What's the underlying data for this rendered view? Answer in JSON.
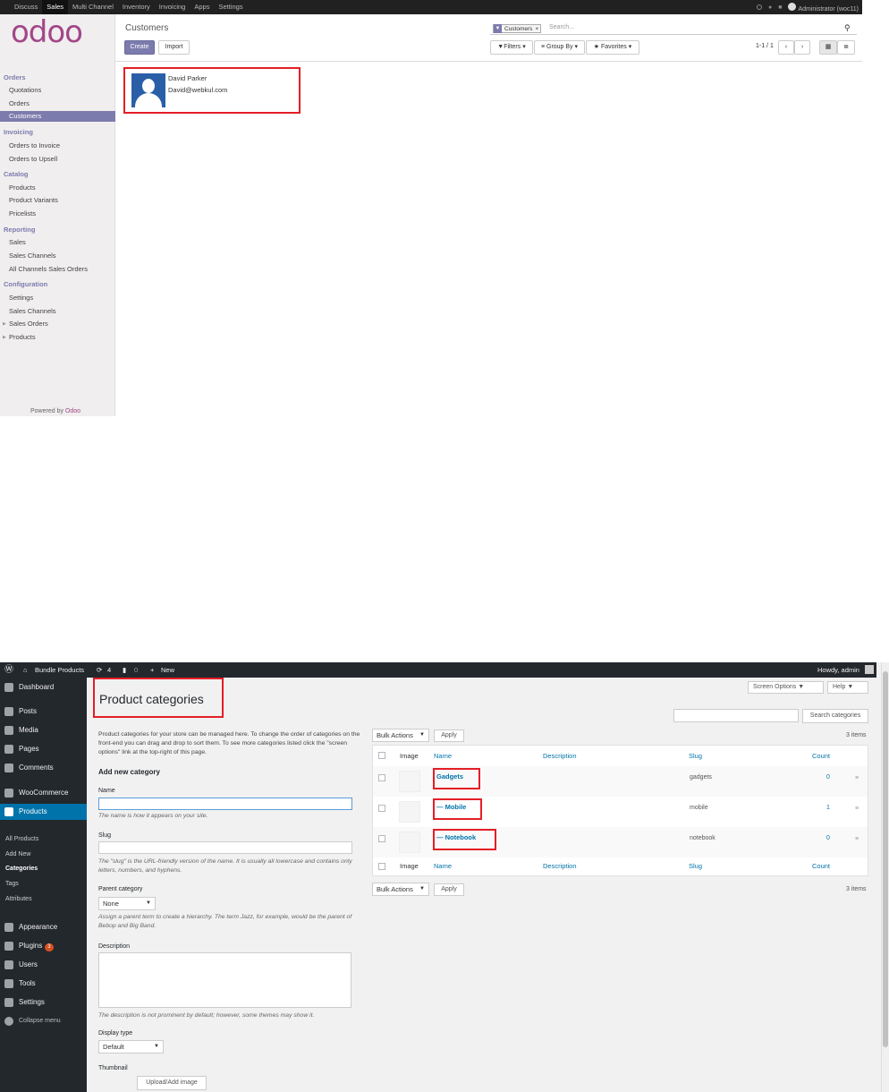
{
  "odoo": {
    "top_menu": [
      "Discuss",
      "Sales",
      "Multi Channel",
      "Inventory",
      "Invoicing",
      "Apps",
      "Settings"
    ],
    "active_menu": "Sales",
    "user": "Administrator (woc11)",
    "logo": "odoo",
    "sidebar": {
      "sections": [
        {
          "title": "Orders",
          "items": [
            "Quotations",
            "Orders",
            "Customers"
          ]
        },
        {
          "title": "Invoicing",
          "items": [
            "Orders to Invoice",
            "Orders to Upsell"
          ]
        },
        {
          "title": "Catalog",
          "items": [
            "Products",
            "Product Variants",
            "Pricelists"
          ]
        },
        {
          "title": "Reporting",
          "items": [
            "Sales",
            "Sales Channels",
            "All Channels Sales Orders"
          ]
        },
        {
          "title": "Configuration",
          "items": [
            "Settings",
            "Sales Channels",
            "Sales Orders",
            "Products"
          ]
        }
      ],
      "selected": "Customers",
      "powered_prefix": "Powered by",
      "powered_brand": "Odoo"
    },
    "page_title": "Customers",
    "create_label": "Create",
    "import_label": "Import",
    "search_facet": "Customers",
    "search_placeholder": "Search...",
    "filters_label": "Filters",
    "groupby_label": "Group By",
    "favorites_label": "Favorites",
    "pager": "1-1 / 1",
    "card": {
      "name": "David Parker",
      "email": "David@webkul.com"
    }
  },
  "wp": {
    "admin_bar": {
      "site": "Bundle Products",
      "updates": "4",
      "comments": "0",
      "new_label": "New",
      "howdy": "Howdy, admin"
    },
    "menu": [
      {
        "label": "Dashboard"
      },
      {
        "label": "Posts"
      },
      {
        "label": "Media"
      },
      {
        "label": "Pages"
      },
      {
        "label": "Comments"
      },
      {
        "label": "WooCommerce"
      },
      {
        "label": "Products"
      },
      {
        "label": "Appearance"
      },
      {
        "label": "Plugins"
      },
      {
        "label": "Users"
      },
      {
        "label": "Tools"
      },
      {
        "label": "Settings"
      },
      {
        "label": "Collapse menu"
      }
    ],
    "plugins_badge": "3",
    "submenu": [
      "All Products",
      "Add New",
      "Categories",
      "Tags",
      "Attributes"
    ],
    "screen_options": "Screen Options",
    "help": "Help",
    "title": "Product categories",
    "search_button": "Search categories",
    "intro": "Product categories for your store can be managed here. To change the order of categories on the front-end you can drag and drop to sort them. To see more categories listed click the \"screen options\" link at the top-right of this page.",
    "add_new_heading": "Add new category",
    "form": {
      "name_label": "Name",
      "name_help": "The name is how it appears on your site.",
      "slug_label": "Slug",
      "slug_help": "The \"slug\" is the URL-friendly version of the name. It is usually all lowercase and contains only letters, numbers, and hyphens.",
      "parent_label": "Parent category",
      "parent_value": "None",
      "parent_help": "Assign a parent term to create a hierarchy. The term Jazz, for example, would be the parent of Bebop and Big Band.",
      "desc_label": "Description",
      "desc_help": "The description is not prominent by default; however, some themes may show it.",
      "display_label": "Display type",
      "display_value": "Default",
      "thumb_label": "Thumbnail",
      "upload_button": "Upload/Add image"
    },
    "bulk_actions": "Bulk Actions",
    "apply": "Apply",
    "items_count": "3 items",
    "columns": [
      "Image",
      "Name",
      "Description",
      "Slug",
      "Count"
    ],
    "rows": [
      {
        "name": "Gadgets",
        "slug": "gadgets",
        "count": "0"
      },
      {
        "name": "— Mobile",
        "slug": "mobile",
        "count": "1"
      },
      {
        "name": "— Notebook",
        "slug": "notebook",
        "count": "0"
      }
    ]
  }
}
